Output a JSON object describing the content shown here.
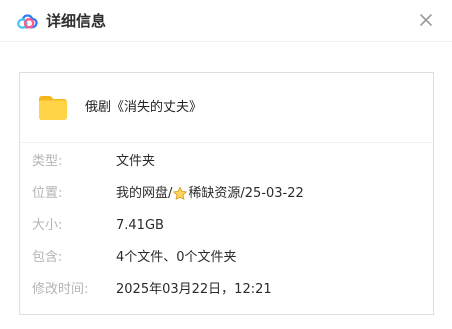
{
  "dialog": {
    "title": "详细信息",
    "icons": {
      "logo": "baidu-netdisk-logo-icon",
      "close": "close-icon",
      "folder": "folder-icon",
      "favorite": "star-icon"
    }
  },
  "folder": {
    "name": "俄剧《消失的丈夫》"
  },
  "details": {
    "type": {
      "label": "类型:",
      "value": "文件夹"
    },
    "location": {
      "label": "位置:",
      "prefix": "我的网盘/",
      "suffix": "稀缺资源/25-03-22"
    },
    "size": {
      "label": "大小:",
      "value": "7.41GB"
    },
    "contains": {
      "label": "包含:",
      "value": "4个文件、0个文件夹"
    },
    "modified": {
      "label": "修改时间:",
      "value": "2025年03月22日，12:21"
    }
  },
  "colors": {
    "title": "#2f2f2f",
    "label": "#b5b5b5",
    "value": "#2b2b2b",
    "border": "#dedede",
    "folder": "#f6c436",
    "logo_blue": "#2f7cf6",
    "logo_cyan": "#45c7f4",
    "logo_pink": "#ff5a8a"
  }
}
